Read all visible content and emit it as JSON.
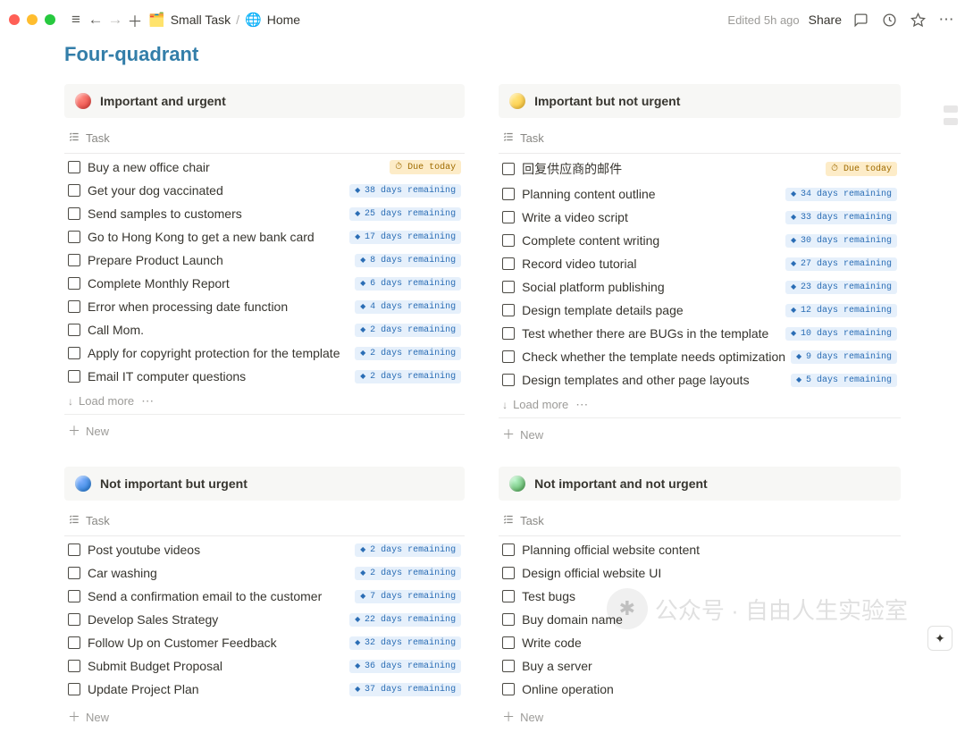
{
  "topbar": {
    "breadcrumb": [
      {
        "emoji": "🗂️",
        "label": "Small Task"
      },
      {
        "emoji": "🌐",
        "label": "Home"
      }
    ],
    "edited": "Edited 5h ago",
    "share": "Share"
  },
  "page_title": "Four-quadrant",
  "column_header": "Task",
  "load_more": "Load more",
  "new_label": "New",
  "due_today": "Due today",
  "quadrants": [
    {
      "id": "q1",
      "color": "red",
      "title": "Important and urgent",
      "tasks": [
        {
          "text": "Buy a new office chair",
          "badge": {
            "type": "due",
            "text": "Due today"
          }
        },
        {
          "text": "Get your dog vaccinated",
          "badge": {
            "type": "remain",
            "text": "38 days remaining"
          }
        },
        {
          "text": "Send samples to customers",
          "badge": {
            "type": "remain",
            "text": "25 days remaining"
          }
        },
        {
          "text": "Go to Hong Kong to get a new bank card",
          "badge": {
            "type": "remain",
            "text": "17 days remaining"
          }
        },
        {
          "text": "Prepare Product Launch",
          "badge": {
            "type": "remain",
            "text": "8 days remaining"
          }
        },
        {
          "text": "Complete Monthly Report",
          "badge": {
            "type": "remain",
            "text": "6 days remaining"
          }
        },
        {
          "text": "Error when processing date function",
          "badge": {
            "type": "remain",
            "text": "4 days remaining"
          }
        },
        {
          "text": "Call Mom.",
          "badge": {
            "type": "remain",
            "text": "2 days remaining"
          }
        },
        {
          "text": "Apply for copyright protection for the template",
          "badge": {
            "type": "remain",
            "text": "2 days remaining"
          }
        },
        {
          "text": "Email IT computer questions",
          "badge": {
            "type": "remain",
            "text": "2 days remaining"
          }
        }
      ],
      "show_load_more": true
    },
    {
      "id": "q2",
      "color": "yellow",
      "title": "Important but not urgent",
      "tasks": [
        {
          "text": "回复供应商的邮件",
          "badge": {
            "type": "due",
            "text": "Due today"
          }
        },
        {
          "text": "Planning content outline",
          "badge": {
            "type": "remain",
            "text": "34 days remaining"
          }
        },
        {
          "text": "Write a video script",
          "badge": {
            "type": "remain",
            "text": "33 days remaining"
          }
        },
        {
          "text": "Complete content writing",
          "badge": {
            "type": "remain",
            "text": "30 days remaining"
          }
        },
        {
          "text": "Record video tutorial",
          "badge": {
            "type": "remain",
            "text": "27 days remaining"
          }
        },
        {
          "text": "Social platform publishing",
          "badge": {
            "type": "remain",
            "text": "23 days remaining"
          }
        },
        {
          "text": "Design template details page",
          "badge": {
            "type": "remain",
            "text": "12 days remaining"
          }
        },
        {
          "text": "Test whether there are BUGs in the template",
          "badge": {
            "type": "remain",
            "text": "10 days remaining"
          }
        },
        {
          "text": "Check whether the template needs optimization",
          "badge": {
            "type": "remain",
            "text": "9 days remaining"
          }
        },
        {
          "text": "Design templates and other page layouts",
          "badge": {
            "type": "remain",
            "text": "5 days remaining"
          }
        }
      ],
      "show_load_more": true
    },
    {
      "id": "q3",
      "color": "blue",
      "title": "Not important but urgent",
      "tasks": [
        {
          "text": "Post youtube videos",
          "badge": {
            "type": "remain",
            "text": "2 days remaining"
          }
        },
        {
          "text": "Car washing",
          "badge": {
            "type": "remain",
            "text": "2 days remaining"
          }
        },
        {
          "text": "Send a confirmation email to the customer",
          "badge": {
            "type": "remain",
            "text": "7 days remaining"
          }
        },
        {
          "text": "Develop Sales Strategy",
          "badge": {
            "type": "remain",
            "text": "22 days remaining"
          }
        },
        {
          "text": "Follow Up on Customer Feedback",
          "badge": {
            "type": "remain",
            "text": "32 days remaining"
          }
        },
        {
          "text": "Submit Budget Proposal",
          "badge": {
            "type": "remain",
            "text": "36 days remaining"
          }
        },
        {
          "text": "Update Project Plan",
          "badge": {
            "type": "remain",
            "text": "37 days remaining"
          }
        }
      ],
      "show_load_more": false
    },
    {
      "id": "q4",
      "color": "green",
      "title": "Not important and not urgent",
      "tasks": [
        {
          "text": "Planning official website content",
          "badge": null
        },
        {
          "text": "Design official website UI",
          "badge": null
        },
        {
          "text": "Test bugs",
          "badge": null
        },
        {
          "text": "Buy domain name",
          "badge": null
        },
        {
          "text": "Write code",
          "badge": null
        },
        {
          "text": "Buy a server",
          "badge": null
        },
        {
          "text": "Online operation",
          "badge": null
        }
      ],
      "show_load_more": false
    }
  ],
  "watermark": "公众号 · 自由人生实验室"
}
